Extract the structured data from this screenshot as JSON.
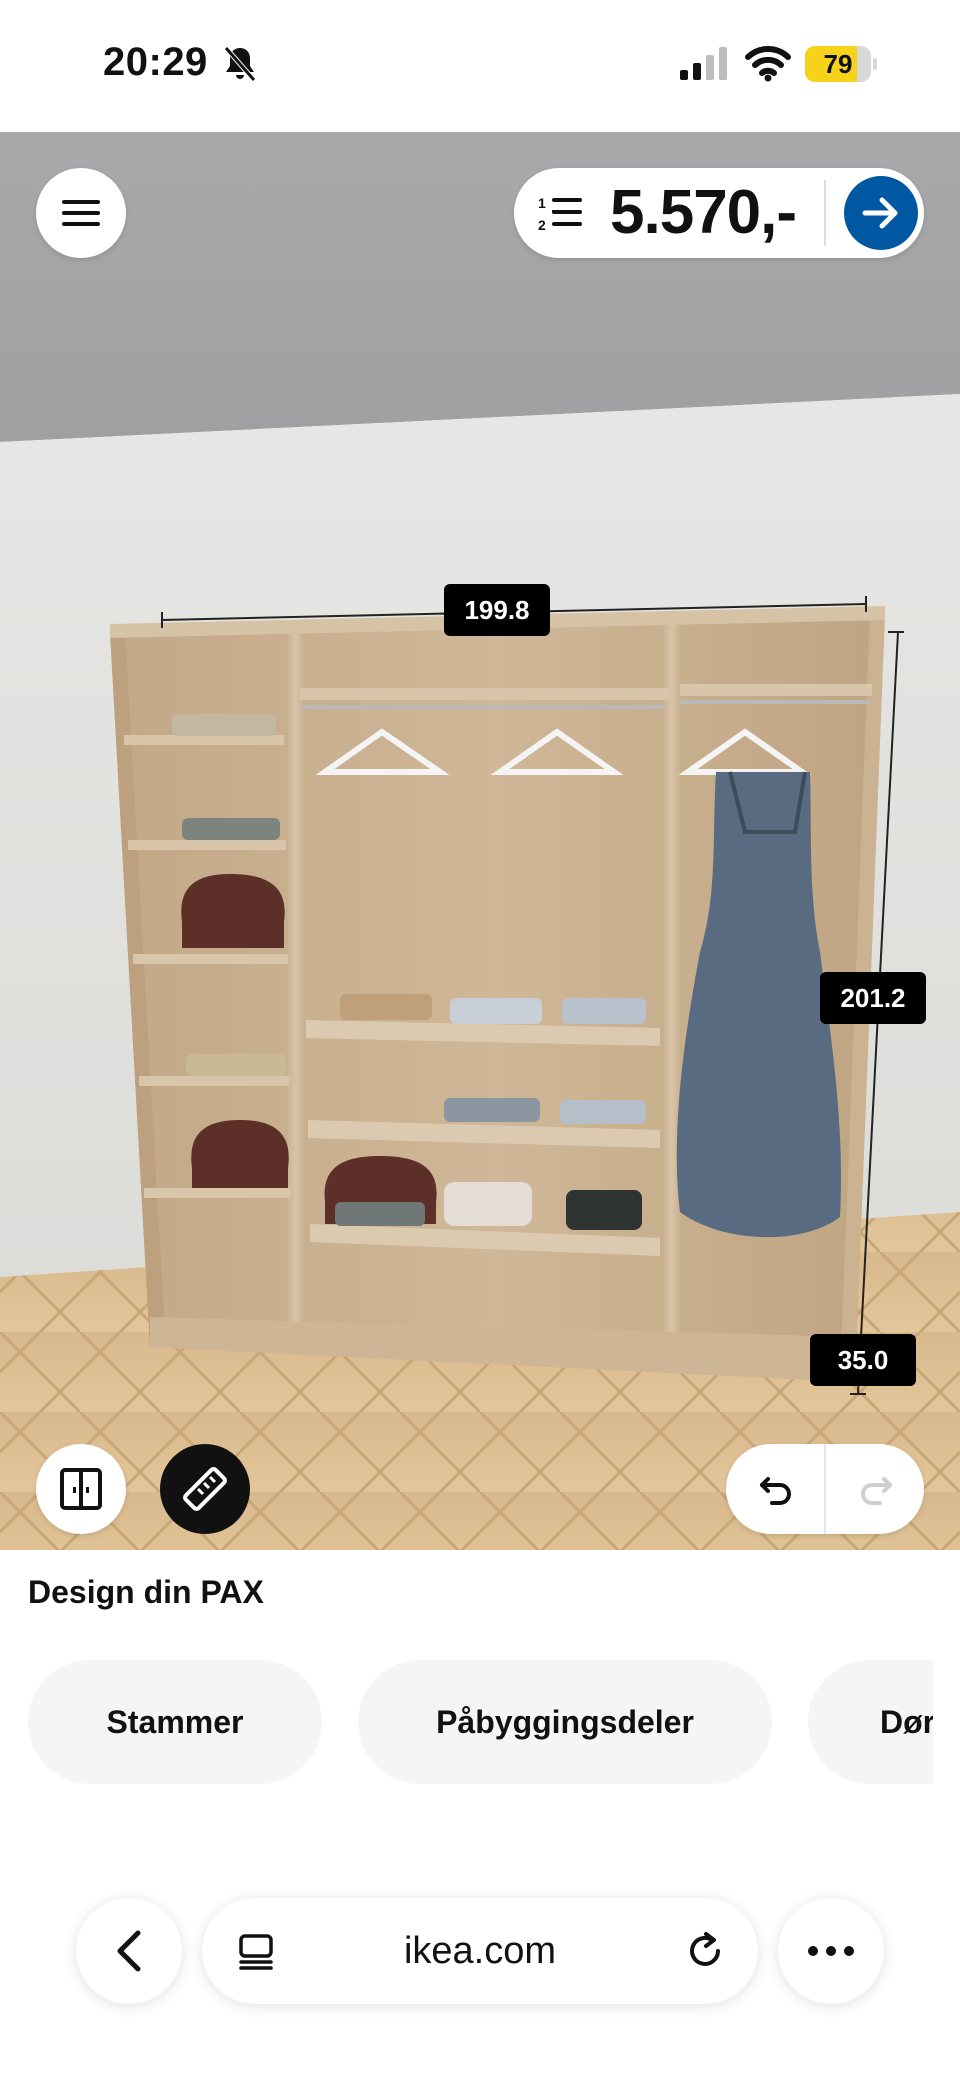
{
  "status_bar": {
    "time": "20:29",
    "battery_level": "79",
    "battery_fraction": 0.79,
    "battery_color": "#f7d21b",
    "icons": [
      "bell-slash-icon",
      "signal-icon",
      "wifi-icon",
      "battery-icon"
    ]
  },
  "viewport": {
    "menu_icon": "hamburger-menu-icon",
    "price": "5.570,-",
    "price_list_icon": "numbered-list-icon",
    "go_icon": "arrow-right-icon",
    "accent_color": "#0058a3",
    "dimensions": {
      "width": "199.8",
      "height": "201.2",
      "depth": "35.0"
    },
    "tools": {
      "door_icon": "door-toggle-icon",
      "measure_icon": "ruler-icon",
      "undo_icon": "undo-icon",
      "redo_icon": "redo-icon"
    }
  },
  "panel": {
    "title": "Design din PAX",
    "chips": [
      "Stammer",
      "Påbyggingsdeler",
      "Dører"
    ]
  },
  "browser": {
    "back_icon": "chevron-left-icon",
    "tabs_icon": "tab-overview-icon",
    "url": "ikea.com",
    "reload_icon": "reload-icon",
    "more_icon": "more-dots-icon"
  }
}
